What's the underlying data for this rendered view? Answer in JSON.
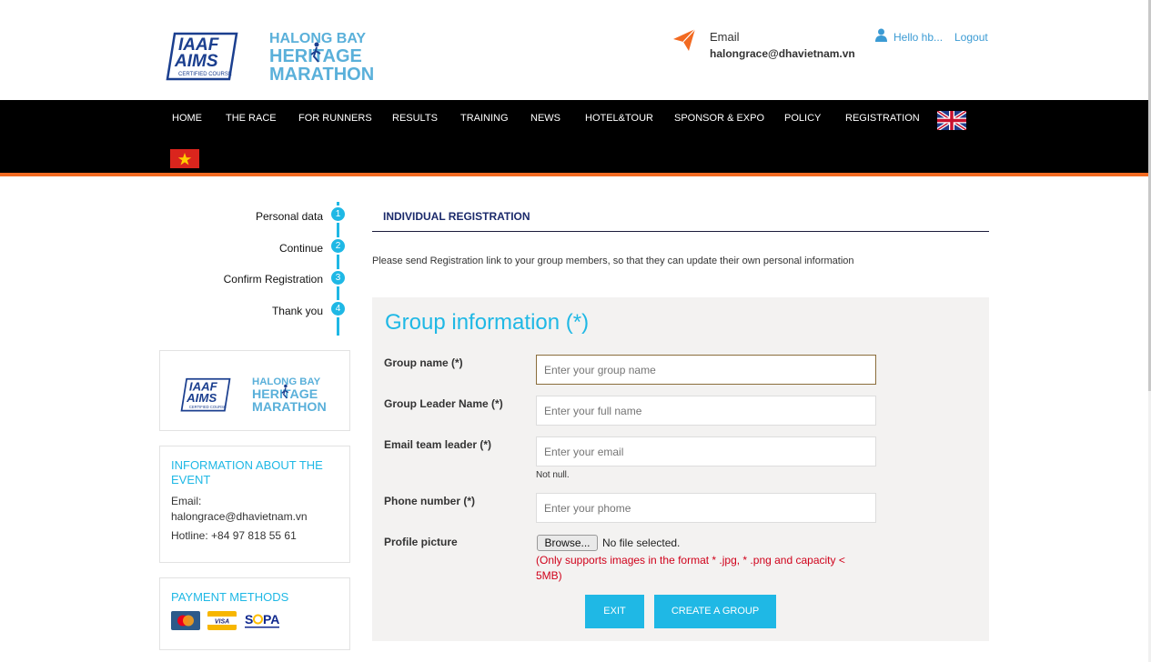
{
  "header": {
    "email_label": "Email",
    "email_value": "halongrace@dhavietnam.vn",
    "greeting": "Hello hb...",
    "logout": "Logout",
    "logo_iaaf_text": [
      "IAAF",
      "AIMS",
      "CERTIFIED COURSE"
    ],
    "logo_halong_text": [
      "HALONG BAY",
      "HERITAGE",
      "MARATHON"
    ]
  },
  "nav": {
    "items": [
      "HOME",
      "THE RACE",
      "FOR RUNNERS",
      "RESULTS",
      "TRAINING",
      "NEWS",
      "HOTEL&TOUR",
      "SPONSOR & EXPO",
      "POLICY",
      "REGISTRATION"
    ]
  },
  "steps": [
    {
      "label": "Personal data",
      "num": "1"
    },
    {
      "label": "Continue",
      "num": "2"
    },
    {
      "label": "Confirm Registration",
      "num": "3"
    },
    {
      "label": "Thank you",
      "num": "4"
    }
  ],
  "sidebar": {
    "info_title": "INFORMATION ABOUT THE EVENT",
    "email_label": "Email:",
    "email_value": "halongrace@dhavietnam.vn",
    "hotline": "Hotline: +84 97 818 55 61",
    "payment_title": "PAYMENT METHODS",
    "payment_icons": [
      "mastercard-icon",
      "visa-icon",
      "sepa-icon"
    ]
  },
  "main": {
    "tab": "INDIVIDUAL REGISTRATION",
    "notice": "Please send Registration link to your group members, so that they can update their own personal information",
    "form_title": "Group information (*)",
    "fields": {
      "group_name": {
        "label": "Group name (*)",
        "placeholder": "Enter your group name"
      },
      "leader_name": {
        "label": "Group Leader Name (*)",
        "placeholder": "Enter your full name"
      },
      "leader_email": {
        "label": "Email team leader (*)",
        "placeholder": "Enter your email",
        "note": "Not null."
      },
      "phone": {
        "label": "Phone number (*)",
        "placeholder": "Enter your phome"
      },
      "picture": {
        "label": "Profile picture",
        "browse": "Browse...",
        "status": "No file selected.",
        "hint": "(Only supports images in the format * .jpg, * .png and capacity < 5MB)"
      }
    },
    "exit_label": "EXIT",
    "create_label": "CREATE A GROUP"
  },
  "colors": {
    "accent": "#1fb8e5",
    "nav_bg": "#000000",
    "nav_border": "#f26a21",
    "link": "#3b9bd4",
    "error": "#d0021b"
  }
}
